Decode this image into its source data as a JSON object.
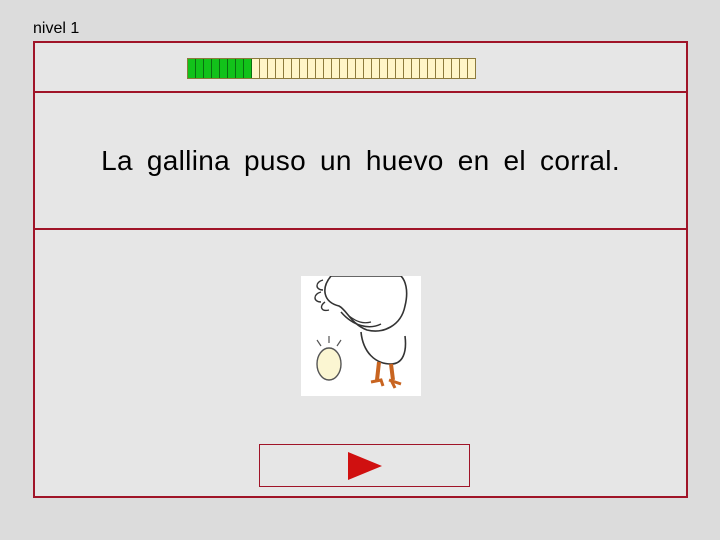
{
  "header": {
    "level_label": "nivel 1"
  },
  "progress": {
    "completed": 8,
    "total": 36,
    "fill_color": "#12c21a",
    "empty_color": "#fff5c8"
  },
  "sentence": {
    "text": "La gallina puso un huevo en el corral."
  },
  "illustration": {
    "icon": "hen-laying-egg-icon"
  },
  "controls": {
    "next_icon": "play-arrow-icon",
    "accent_color": "#a01428",
    "arrow_color": "#d01010"
  }
}
